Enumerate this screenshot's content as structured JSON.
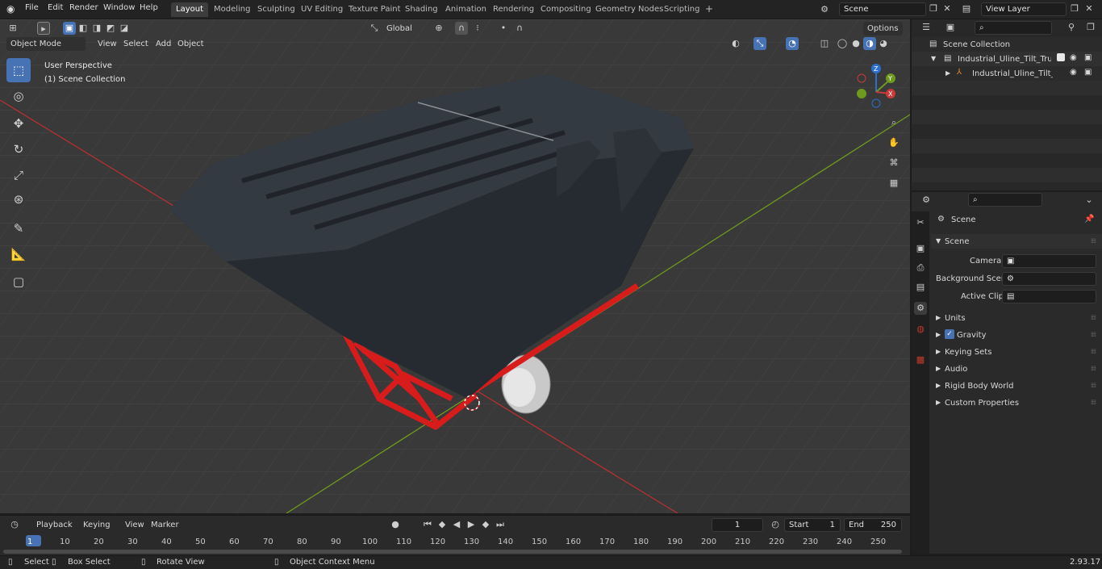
{
  "menu": {
    "file": "File",
    "edit": "Edit",
    "render": "Render",
    "window": "Window",
    "help": "Help"
  },
  "workspaces": [
    "Layout",
    "Modeling",
    "Sculpting",
    "UV Editing",
    "Texture Paint",
    "Shading",
    "Animation",
    "Rendering",
    "Compositing",
    "Geometry Nodes",
    "Scripting"
  ],
  "active_workspace": "Layout",
  "scene_field": "Scene",
  "view_layer_field": "View Layer",
  "viewport_header": {
    "mode": "Object Mode",
    "view": "View",
    "select": "Select",
    "add": "Add",
    "object": "Object",
    "orientation": "Global",
    "options": "Options"
  },
  "overlay": {
    "perspective": "User Perspective",
    "collection": "(1) Scene Collection"
  },
  "gizmo": {
    "z": "Z",
    "y": "Y",
    "x": "X"
  },
  "outliner": {
    "root": "Scene Collection",
    "items": [
      {
        "label": "Industrial_Uline_Tilt_Truck_Bla"
      },
      {
        "label": "Industrial_Uline_Tilt_Truck"
      }
    ]
  },
  "properties": {
    "context": "Scene",
    "panel": "Scene",
    "camera_label": "Camera",
    "background_label": "Background Scene",
    "clip_label": "Active Clip",
    "subpanels": [
      "Units",
      "Gravity",
      "Keying Sets",
      "Audio",
      "Rigid Body World",
      "Custom Properties"
    ]
  },
  "timeline": {
    "playback": "Playback",
    "keying": "Keying",
    "view": "View",
    "marker": "Marker",
    "current_frame": "1",
    "start_label": "Start",
    "start": "1",
    "end_label": "End",
    "end": "250",
    "ticks": [
      "1",
      "10",
      "20",
      "30",
      "40",
      "50",
      "60",
      "70",
      "80",
      "90",
      "100",
      "110",
      "120",
      "130",
      "140",
      "150",
      "160",
      "170",
      "180",
      "190",
      "200",
      "210",
      "220",
      "230",
      "240",
      "250"
    ]
  },
  "status": {
    "select": "Select",
    "box": "Box Select",
    "rotate": "Rotate View",
    "context": "Object Context Menu",
    "version": "2.93.17"
  },
  "colors": {
    "accent": "#4772b3",
    "frame": "#e02020",
    "axis_x": "#b53030",
    "axis_y": "#6e9a1e"
  }
}
